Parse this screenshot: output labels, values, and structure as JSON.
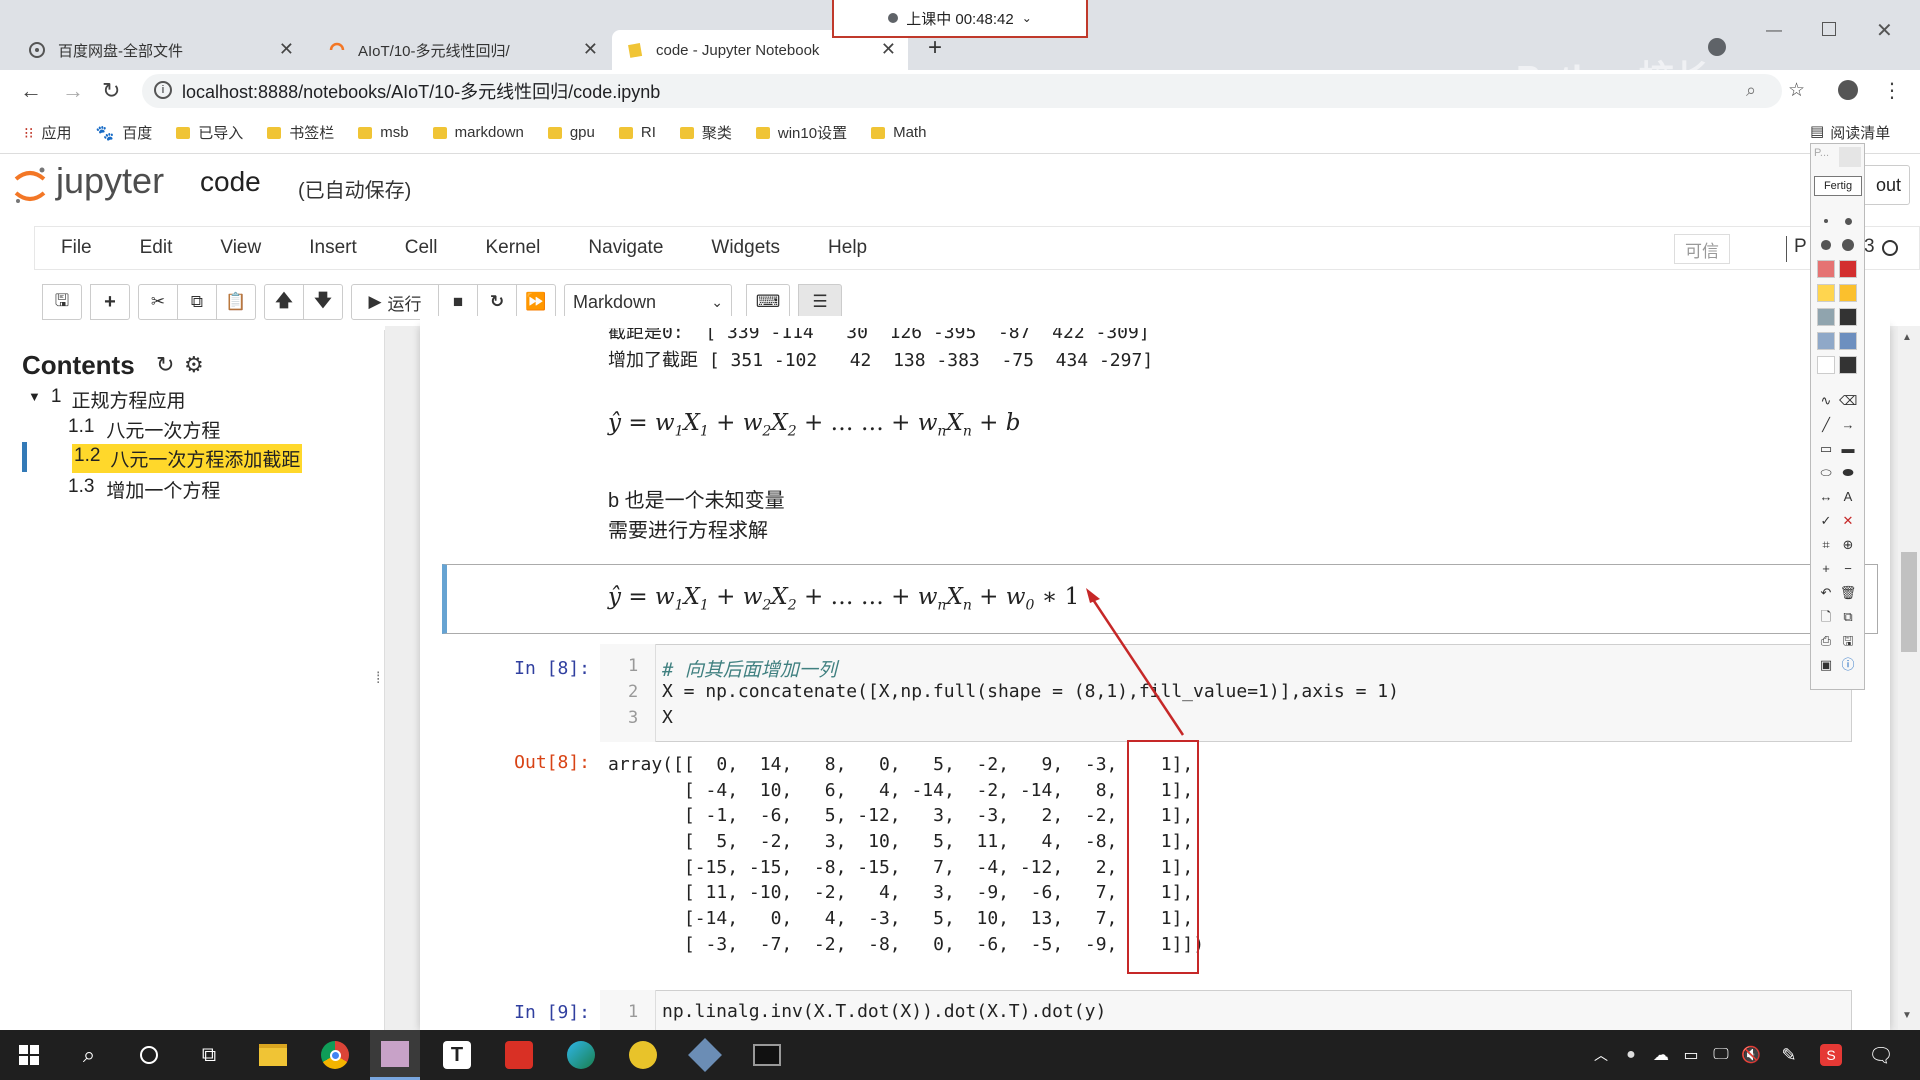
{
  "browser": {
    "tabs": [
      {
        "label": "百度网盘-全部文件",
        "active": false
      },
      {
        "label": "AIoT/10-多元线性回归/",
        "active": false
      },
      {
        "label": "code - Jupyter Notebook",
        "active": true
      }
    ],
    "recording": {
      "label": "上课中 00:48:42"
    },
    "watermark": "Python校长",
    "url": "localhost:8888/notebooks/AIoT/10-多元线性回归/code.ipynb",
    "bookmarks": [
      "应用",
      "百度",
      "已导入",
      "书签栏",
      "msb",
      "markdown",
      "gpu",
      "RI",
      "聚类",
      "win10设置",
      "Math"
    ],
    "reading_list": "阅读清单"
  },
  "jupyter": {
    "logo": "jupyter",
    "notebook_name": "code",
    "autosave": "(已自动保存)",
    "logout": "out",
    "menu": [
      "File",
      "Edit",
      "View",
      "Insert",
      "Cell",
      "Kernel",
      "Navigate",
      "Widgets",
      "Help"
    ],
    "trusted": "可信",
    "kernel_partial_p": "P",
    "kernel_partial_3": "3",
    "toolbar": {
      "run_label": "运行",
      "cell_type": "Markdown"
    }
  },
  "toc": {
    "title": "Contents",
    "items": [
      {
        "num": "1",
        "label": "正规方程应用",
        "level": 1,
        "active": false
      },
      {
        "num": "1.1",
        "label": "八元一次方程",
        "level": 2,
        "active": false
      },
      {
        "num": "1.2",
        "label": "八元一次方程添加截距",
        "level": 2,
        "active": true
      },
      {
        "num": "1.3",
        "label": "增加一个方程",
        "level": 2,
        "active": false
      }
    ]
  },
  "cells": {
    "output_top": {
      "line1_label": "截距是0:",
      "line1_values": "[ 339 -114   30  126 -395  -87  422 -309]",
      "line2_label": "增加了截距",
      "line2_values": "[ 351 -102   42  138 -383  -75  434 -297]"
    },
    "text1": "b 也是一个未知变量",
    "text2": "需要进行方程求解",
    "cell8": {
      "prompt": "In  [8]:",
      "lines": [
        {
          "no": "1",
          "code": "# 向其后面增加一列"
        },
        {
          "no": "2",
          "code": "X = np.concatenate([X,np.full(shape = (8,1),fill_value=1)],axis = 1)"
        },
        {
          "no": "3",
          "code": "X"
        }
      ]
    },
    "out8": {
      "prompt": "Out[8]:",
      "prefix_first": "array([[",
      "matrix": [
        [
          0,
          14,
          8,
          0,
          5,
          -2,
          9,
          -3,
          1
        ],
        [
          -4,
          10,
          6,
          4,
          -14,
          -2,
          -14,
          8,
          1
        ],
        [
          -1,
          -6,
          5,
          -12,
          3,
          -3,
          2,
          -2,
          1
        ],
        [
          5,
          -2,
          3,
          10,
          5,
          11,
          4,
          -8,
          1
        ],
        [
          -15,
          -15,
          -8,
          -15,
          7,
          -4,
          -12,
          2,
          1
        ],
        [
          11,
          -10,
          -2,
          4,
          3,
          -9,
          -6,
          7,
          1
        ],
        [
          -14,
          0,
          4,
          -3,
          5,
          10,
          13,
          7,
          1
        ],
        [
          -3,
          -7,
          -2,
          -8,
          0,
          -6,
          -5,
          -9,
          1
        ]
      ]
    },
    "cell9": {
      "prompt": "In  [9]:",
      "line_no": "1",
      "code": "np.linalg.inv(X.T.dot(X)).dot(X.T).dot(y)"
    }
  },
  "palette": {
    "input_placeholder": "P...",
    "button": "Fertig"
  },
  "annotation_color": "#c62828"
}
